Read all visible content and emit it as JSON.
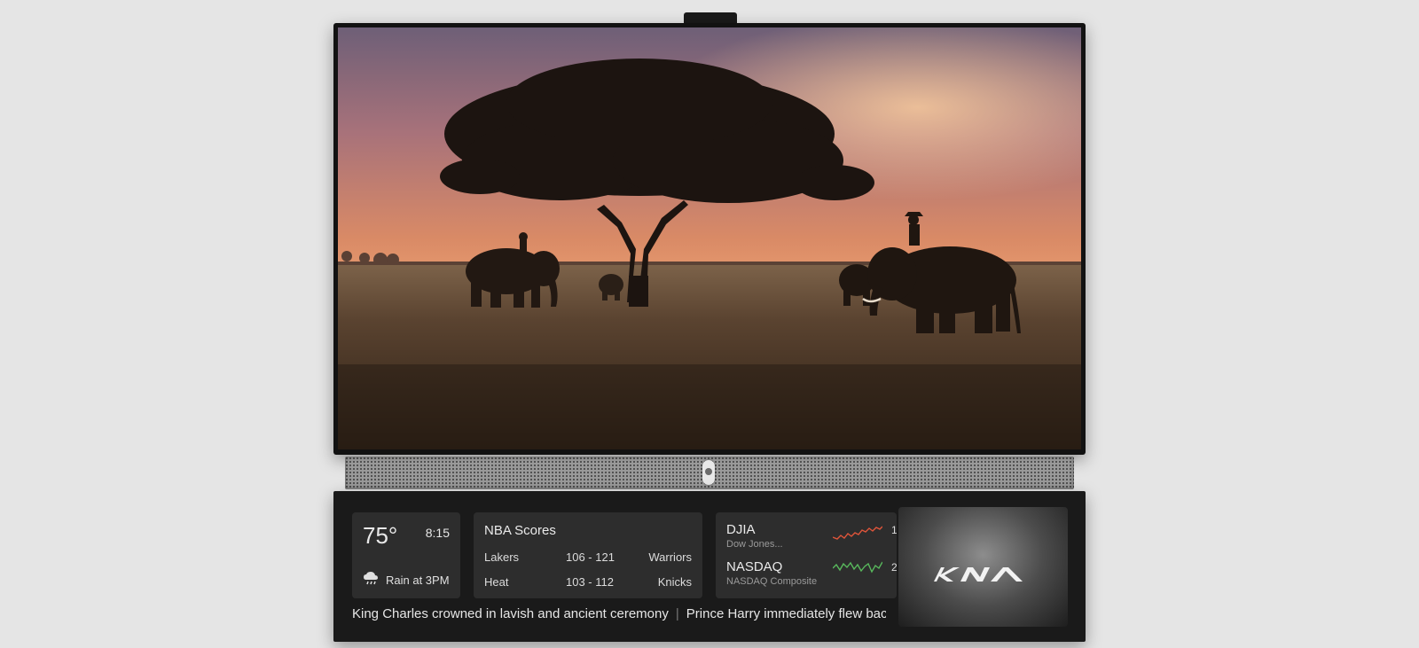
{
  "weather": {
    "temperature": "75°",
    "time": "8:15",
    "forecast": "Rain at 3PM",
    "icon": "rain-cloud-icon"
  },
  "nba": {
    "title": "NBA Scores",
    "games": [
      {
        "home": "Lakers",
        "score": "106 - 121",
        "away": "Warriors"
      },
      {
        "home": "Heat",
        "score": "103 - 112",
        "away": "Knicks"
      }
    ]
  },
  "stocks": [
    {
      "symbol": "DJIA",
      "name": "Dow Jones...",
      "trend_color": "#e0553a",
      "clip": "1"
    },
    {
      "symbol": "NASDAQ",
      "name": "NASDAQ Composite",
      "trend_color": "#58b85c",
      "clip": "2"
    }
  ],
  "ad": {
    "brand": "KIA"
  },
  "ticker": {
    "headlines": [
      "King Charles crowned in lavish and ancient ceremony",
      "Prince Harry immediately flew back"
    ]
  }
}
